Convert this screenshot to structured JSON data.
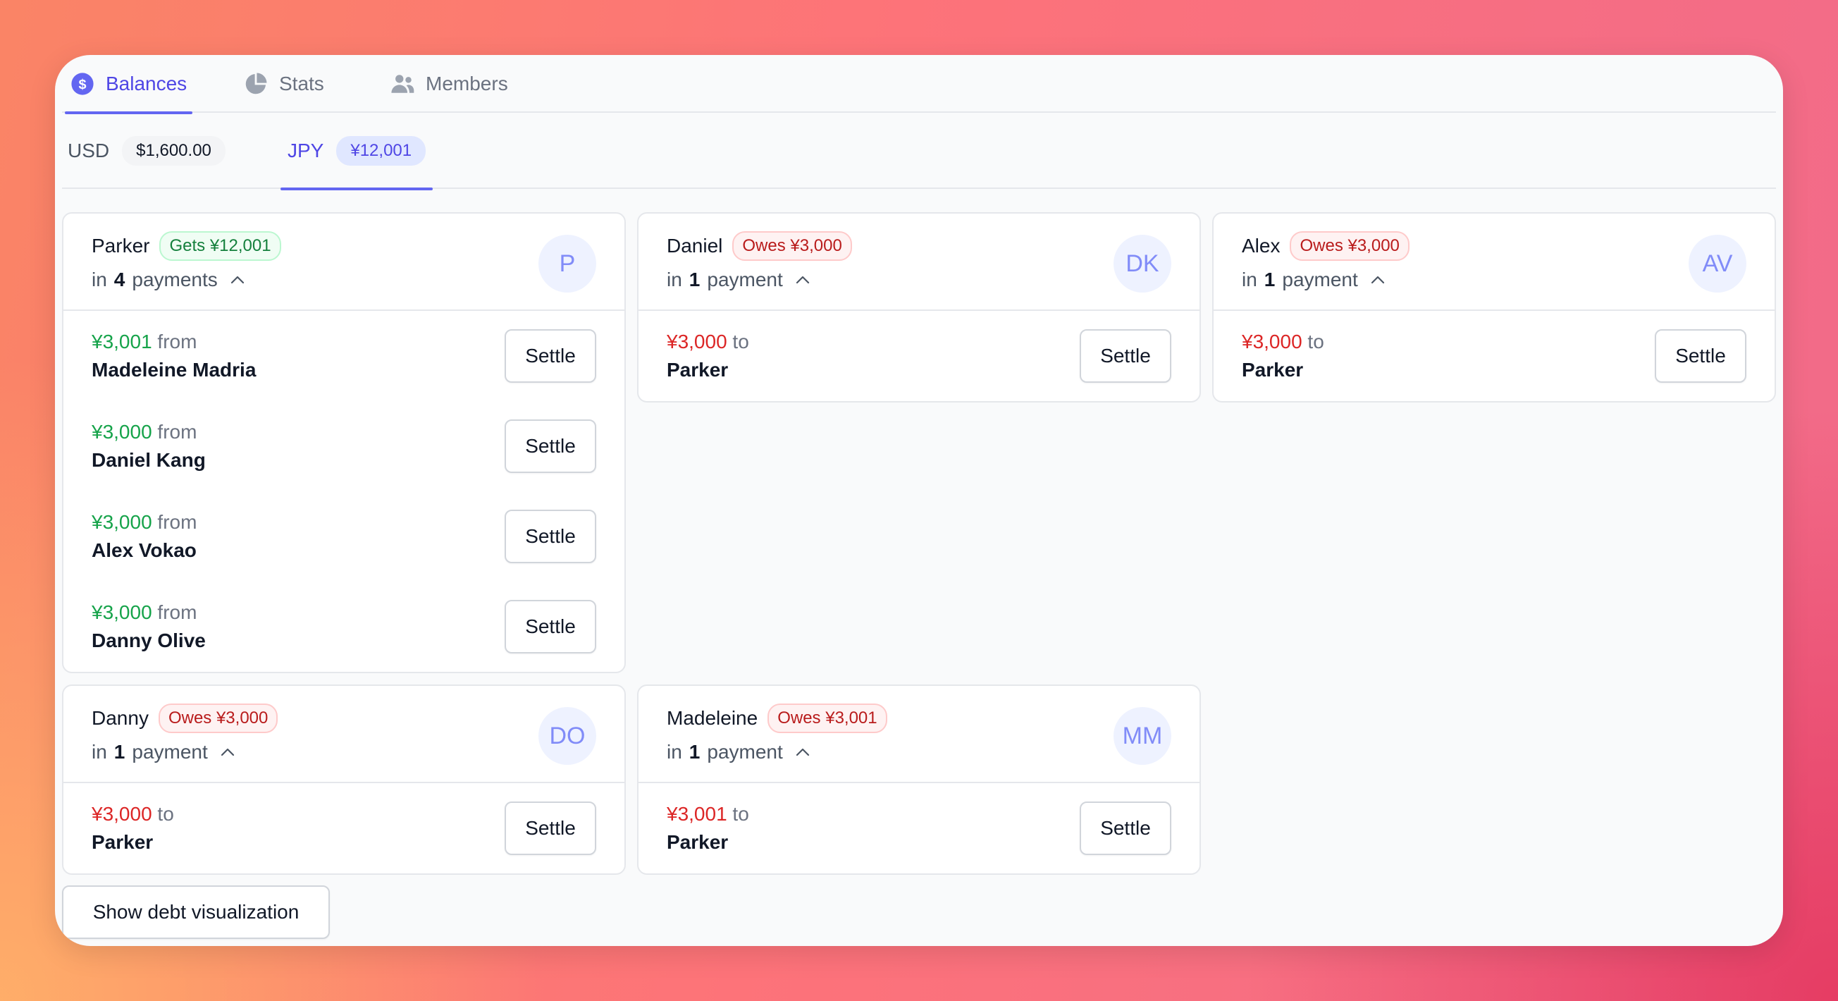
{
  "tabs": [
    {
      "label": "Balances",
      "icon": "dollar-circle-icon"
    },
    {
      "label": "Stats",
      "icon": "pie-chart-icon"
    },
    {
      "label": "Members",
      "icon": "users-icon"
    }
  ],
  "currencies": [
    {
      "code": "USD",
      "total": "$1,600.00"
    },
    {
      "code": "JPY",
      "total": "¥12,001"
    }
  ],
  "cards": [
    {
      "name": "Parker",
      "badge": "Gets ¥12,001",
      "initials": "P",
      "count_prefix": "in",
      "count": "4",
      "count_suffix": "payments",
      "rows": [
        {
          "amount": "¥3,001",
          "direction": "from",
          "person": "Madeleine Madria",
          "action": "Settle"
        },
        {
          "amount": "¥3,000",
          "direction": "from",
          "person": "Daniel Kang",
          "action": "Settle"
        },
        {
          "amount": "¥3,000",
          "direction": "from",
          "person": "Alex Vokao",
          "action": "Settle"
        },
        {
          "amount": "¥3,000",
          "direction": "from",
          "person": "Danny Olive",
          "action": "Settle"
        }
      ]
    },
    {
      "name": "Daniel",
      "badge": "Owes ¥3,000",
      "initials": "DK",
      "count_prefix": "in",
      "count": "1",
      "count_suffix": "payment",
      "rows": [
        {
          "amount": "¥3,000",
          "direction": "to",
          "person": "Parker",
          "action": "Settle"
        }
      ]
    },
    {
      "name": "Alex",
      "badge": "Owes ¥3,000",
      "initials": "AV",
      "count_prefix": "in",
      "count": "1",
      "count_suffix": "payment",
      "rows": [
        {
          "amount": "¥3,000",
          "direction": "to",
          "person": "Parker",
          "action": "Settle"
        }
      ]
    },
    {
      "name": "Danny",
      "badge": "Owes ¥3,000",
      "initials": "DO",
      "count_prefix": "in",
      "count": "1",
      "count_suffix": "payment",
      "rows": [
        {
          "amount": "¥3,000",
          "direction": "to",
          "person": "Parker",
          "action": "Settle"
        }
      ]
    },
    {
      "name": "Madeleine",
      "badge": "Owes ¥3,001",
      "initials": "MM",
      "count_prefix": "in",
      "count": "1",
      "count_suffix": "payment",
      "rows": [
        {
          "amount": "¥3,001",
          "direction": "to",
          "person": "Parker",
          "action": "Settle"
        }
      ]
    }
  ],
  "footer": {
    "viz_button": "Show debt visualization"
  },
  "colors": {
    "accent": "#4f46e5",
    "positive": "#16a34a",
    "negative": "#dc2626"
  }
}
